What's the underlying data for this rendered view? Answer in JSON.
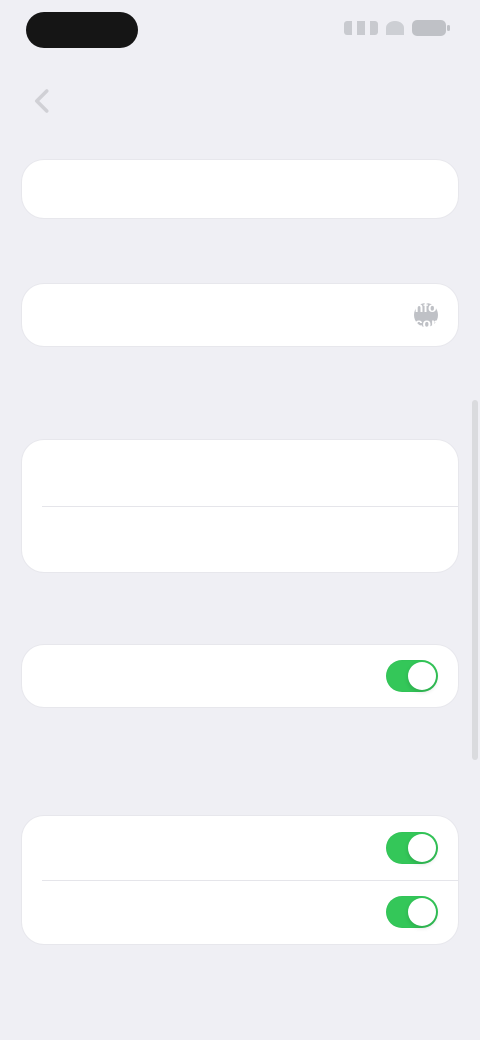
{
  "nav": {
    "title": "",
    "back_icon": "chevron-left-icon"
  },
  "top_item": {
    "label": ""
  },
  "section1": {
    "header": "",
    "row_label": "",
    "info_icon": "info-icon",
    "footnote": ""
  },
  "section2": {
    "header": "",
    "row1": "",
    "row2": "",
    "footnote": ""
  },
  "section3": {
    "row_label": "",
    "toggle_on": true,
    "footnote": ""
  },
  "section4": {
    "header": "",
    "row1": "",
    "row2": "",
    "toggle1_on": true,
    "toggle2_on": true,
    "footnote": ""
  },
  "colors": {
    "background": "#efeff4",
    "card": "#ffffff",
    "toggle_on": "#34c759",
    "status_pill": "#151515"
  }
}
